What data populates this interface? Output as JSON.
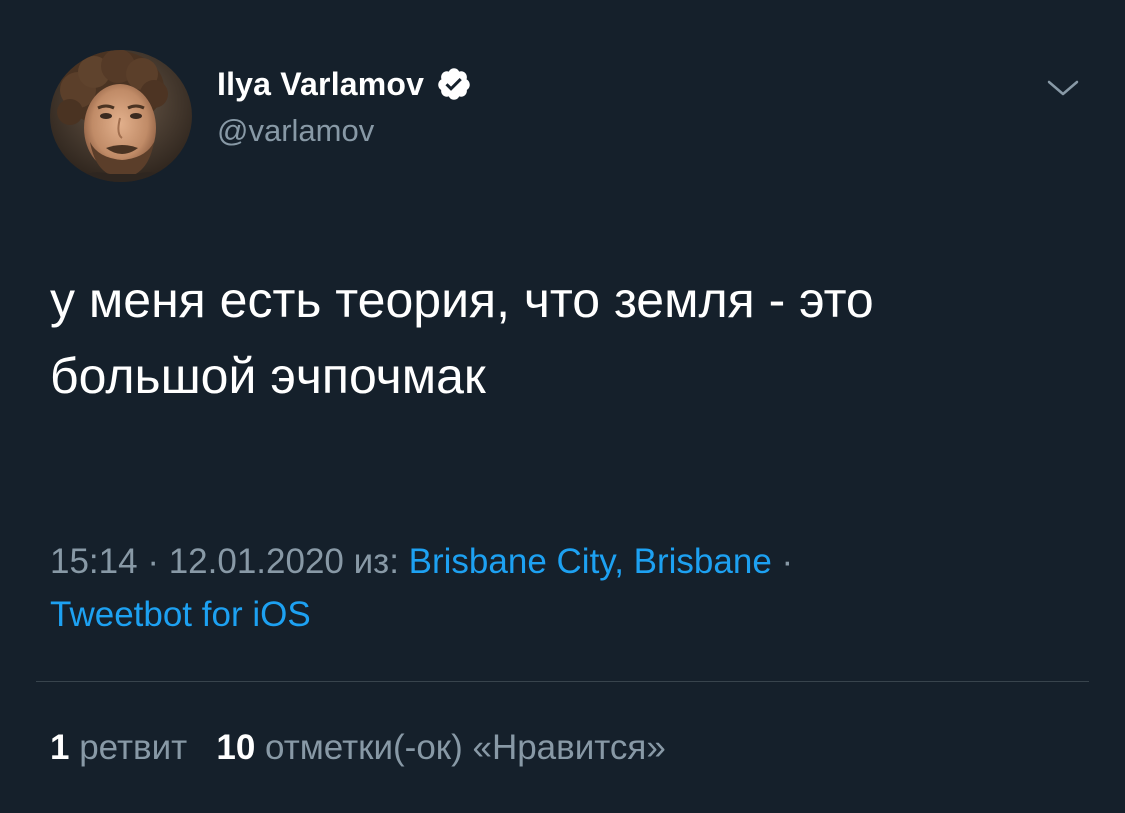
{
  "author": {
    "display_name": "Ilya Varlamov",
    "handle": "@varlamov",
    "verified": true
  },
  "icons": {
    "verified": "verified-badge-icon",
    "menu": "chevron-down-icon",
    "avatar": "profile-photo"
  },
  "tweet": {
    "text": "у меня есть теория, что земля - это большой эчпочмак"
  },
  "meta": {
    "time": "15:14",
    "separator_1": " · ",
    "date": "12.01.2020",
    "from_label": " из: ",
    "location": "Brisbane City, Brisbane",
    "separator_2": " · ",
    "source": "Tweetbot for iOS"
  },
  "stats": {
    "retweets_count": "1",
    "retweets_label": " ретвит",
    "likes_count": "10",
    "likes_label": " отметки(-ок) «Нравится»"
  },
  "colors": {
    "background": "#15202b",
    "text": "#ffffff",
    "secondary": "#8899a6",
    "link": "#1da1f2",
    "divider": "#38444d"
  }
}
